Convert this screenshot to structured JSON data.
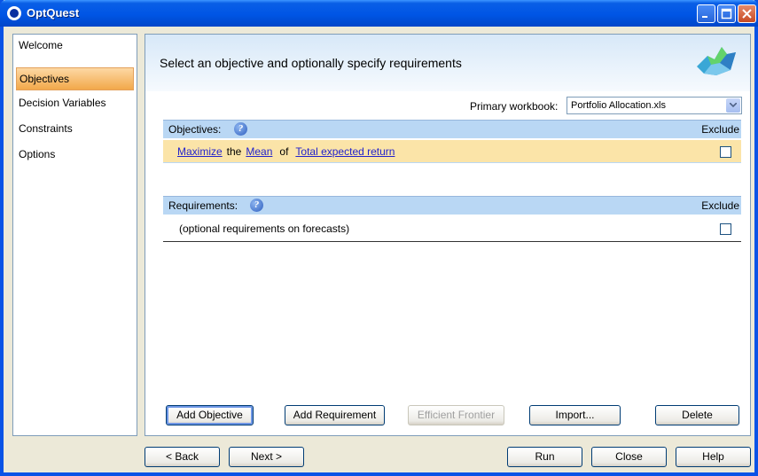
{
  "window": {
    "title": "OptQuest"
  },
  "sidebar": {
    "items": [
      {
        "label": "Welcome"
      },
      {
        "label": "Objectives"
      },
      {
        "label": "Decision Variables"
      },
      {
        "label": "Constraints"
      },
      {
        "label": "Options"
      }
    ],
    "active_index": 1
  },
  "main": {
    "title": "Select an objective and optionally specify requirements",
    "primary_workbook_label": "Primary workbook:",
    "primary_workbook_value": "Portfolio Allocation.xls",
    "objectives": {
      "header": "Objectives:",
      "exclude_label": "Exclude",
      "rows": [
        {
          "verb": "Maximize",
          "the": "the",
          "stat": "Mean",
          "of": "of",
          "forecast": "Total expected return",
          "excluded": false
        }
      ]
    },
    "requirements": {
      "header": "Requirements:",
      "exclude_label": "Exclude",
      "rows": [
        {
          "text": "(optional requirements on forecasts)",
          "excluded": false
        }
      ]
    },
    "buttons": {
      "add_objective": "Add Objective",
      "add_requirement": "Add Requirement",
      "efficient_frontier": "Efficient Frontier",
      "import": "Import...",
      "delete": "Delete"
    }
  },
  "footer": {
    "back": "< Back",
    "next": "Next >",
    "run": "Run",
    "close": "Close",
    "help": "Help"
  },
  "colors": {
    "titlebar": "#0055E5",
    "active_nav": "#F2A84A",
    "section_header": "#B9D7F4",
    "objective_row": "#FBE4A8",
    "link": "#2222CC"
  }
}
